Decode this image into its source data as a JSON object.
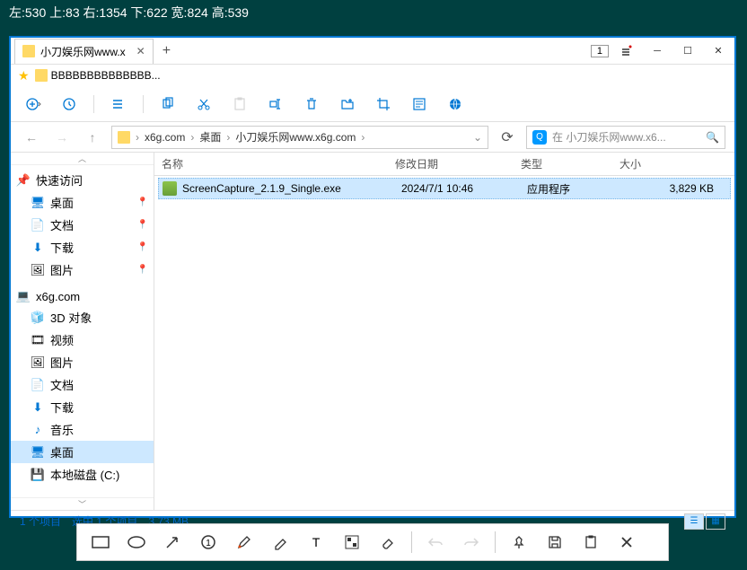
{
  "overlay": "左:530  上:83  右:1354  下:622  宽:824  高:539",
  "tab": {
    "title": "小刀娱乐网www.x",
    "badge": "1"
  },
  "bookmark": "BBBBBBBBBBBBBB...",
  "breadcrumb": {
    "p1": "x6g.com",
    "p2": "桌面",
    "p3": "小刀娱乐网www.x6g.com"
  },
  "search": {
    "placeholder": "在 小刀娱乐网www.x6..."
  },
  "cols": {
    "name": "名称",
    "date": "修改日期",
    "type": "类型",
    "size": "大小"
  },
  "sidebar": {
    "quick": "快速访问",
    "desktop": "桌面",
    "docs": "文档",
    "downloads": "下载",
    "pictures": "图片",
    "pc": "x6g.com",
    "objects3d": "3D 对象",
    "videos": "视频",
    "pictures2": "图片",
    "docs2": "文档",
    "downloads2": "下载",
    "music": "音乐",
    "desktop2": "桌面",
    "cdrive": "本地磁盘 (C:)"
  },
  "file": {
    "name": "ScreenCapture_2.1.9_Single.exe",
    "date": "2024/7/1 10:46",
    "type": "应用程序",
    "size": "3,829 KB"
  },
  "status": {
    "items": "1 个项目",
    "selected": "选中 1 个项目",
    "size": "3.73 MB"
  }
}
